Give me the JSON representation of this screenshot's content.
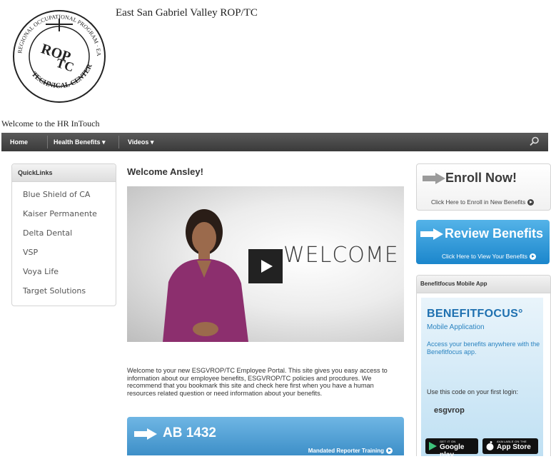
{
  "header": {
    "org_name": "East San Gabriel Valley ROP/TC",
    "welcome_line": "Welcome to the HR InTouch",
    "logo_text": "EAST SAN GABRIEL VALLEY REGIONAL OCCUPATIONAL PROGRAM TECHNICAL CENTER ROP/TC"
  },
  "nav": {
    "home": "Home",
    "health_benefits": "Health Benefits ▾",
    "videos": "Videos ▾"
  },
  "quicklinks": {
    "title": "QuickLinks",
    "items": [
      "Blue Shield of CA",
      "Kaiser Permanente",
      "Delta Dental",
      "VSP",
      "Voya Life",
      "Target Solutions"
    ]
  },
  "main": {
    "title": "Welcome Ansley!",
    "video_text": "WELCOME",
    "intro": "Welcome to your new ESGVROP/TC Employee Portal. This site gives you easy access to information about our employee benefits, ESGVROP/TC policies and procdures. We recommend that you bookmark this site and check here first when you have a human resources related question or need information about your benefits.",
    "ab_title": "AB 1432",
    "ab_sub": "Mandated Reporter Training"
  },
  "sidebar": {
    "enroll_title": "Enroll Now!",
    "enroll_sub": "Click Here to Enroll in New Benefits",
    "review_title": "Review Benefits",
    "review_sub": "Click Here to View Your Benefits",
    "bf_title": "Benefitfocus Mobile App",
    "bf_logo": "BENEFITFOCUS°",
    "bf_app": "Mobile Application",
    "bf_access": "Access your benefits anywhere with the Benefitfocus app.",
    "bf_code_label": "Use this code on your first login:",
    "bf_code": "esgvrop",
    "google_small": "GET IT ON",
    "google_big": "Google play",
    "apple_small": "AVAILABLE ON THE",
    "apple_big": "App Store"
  },
  "colors": {
    "nav_bg": "#444444",
    "accent_blue": "#1b86cc",
    "banner_blue": "#3d8fc8"
  }
}
